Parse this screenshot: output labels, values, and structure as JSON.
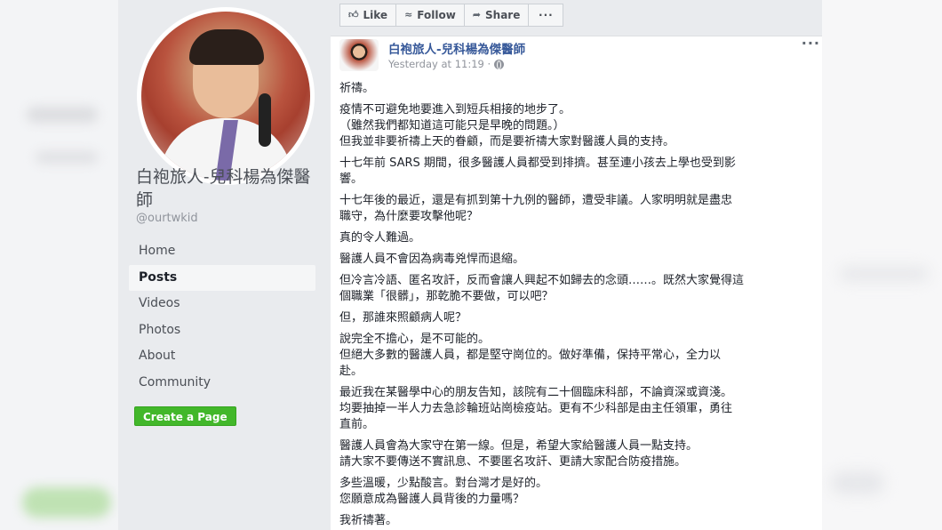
{
  "page": {
    "name": "白袍旅人-兒科楊為傑醫師",
    "handle": "@ourtwkid"
  },
  "nav": {
    "items": [
      {
        "label": "Home"
      },
      {
        "label": "Posts",
        "active": true
      },
      {
        "label": "Videos"
      },
      {
        "label": "Photos"
      },
      {
        "label": "About"
      },
      {
        "label": "Community"
      }
    ],
    "create_page": "Create a Page"
  },
  "actions": {
    "like": "Like",
    "follow": "Follow",
    "share": "Share",
    "more": "···"
  },
  "post": {
    "author": "白袍旅人-兒科楊為傑醫師",
    "time": "Yesterday at 11:19 ·",
    "menu": "···",
    "paragraphs": [
      [
        "祈禱。"
      ],
      [
        "疫情不可避免地要進入到短兵相接的地步了。",
        "（雖然我們都知道這可能只是早晚的問題。）",
        "但我並非要祈禱上天的眷顧，而是要祈禱大家對醫護人員的支持。"
      ],
      [
        "十七年前 SARS 期間，很多醫護人員都受到排擠。甚至連小孩去上學也受到影",
        "響。"
      ],
      [
        "十七年後的最近，還是有抓到第十九例的醫師，遭受非議。人家明明就是盡忠",
        "職守，為什麼要攻擊他呢？"
      ],
      [
        "真的令人難過。"
      ],
      [
        "醫護人員不會因為病毒兇悍而退縮。"
      ],
      [
        "但冷言冷語、匿名攻訐，反而會讓人興起不如歸去的念頭……。既然大家覺得這",
        "個職業「很髒」，那乾脆不要做，可以吧？"
      ],
      [
        "但，那誰來照顧病人呢？"
      ],
      [
        "說完全不擔心，是不可能的。",
        "但絕大多數的醫護人員，都是堅守崗位的。做好準備，保持平常心，全力以",
        "赴。"
      ],
      [
        "最近我在某醫學中心的朋友告知，該院有二十個臨床科部，不論資深或資淺。",
        "均要抽掉一半人力去急診輪班站崗檢疫站。更有不少科部是由主任領軍，勇往",
        "直前。"
      ],
      [
        "醫護人員會為大家守在第一線。但是，希望大家給醫護人員一點支持。",
        "請大家不要傳送不實訊息、不要匿名攻訐、更請大家配合防疫措施。"
      ],
      [
        "多些溫暖，少點酸言。對台灣才是好的。",
        "您願意成為醫護人員背後的力量嗎？"
      ],
      [
        "我祈禱著。"
      ]
    ]
  },
  "icons": {
    "like": "thumbs-up-icon",
    "follow": "rss-icon",
    "share": "share-arrow-icon",
    "privacy": "globe-icon"
  },
  "colors": {
    "link": "#365899",
    "create_button": "#42b72a",
    "background": "#e9ebee"
  }
}
